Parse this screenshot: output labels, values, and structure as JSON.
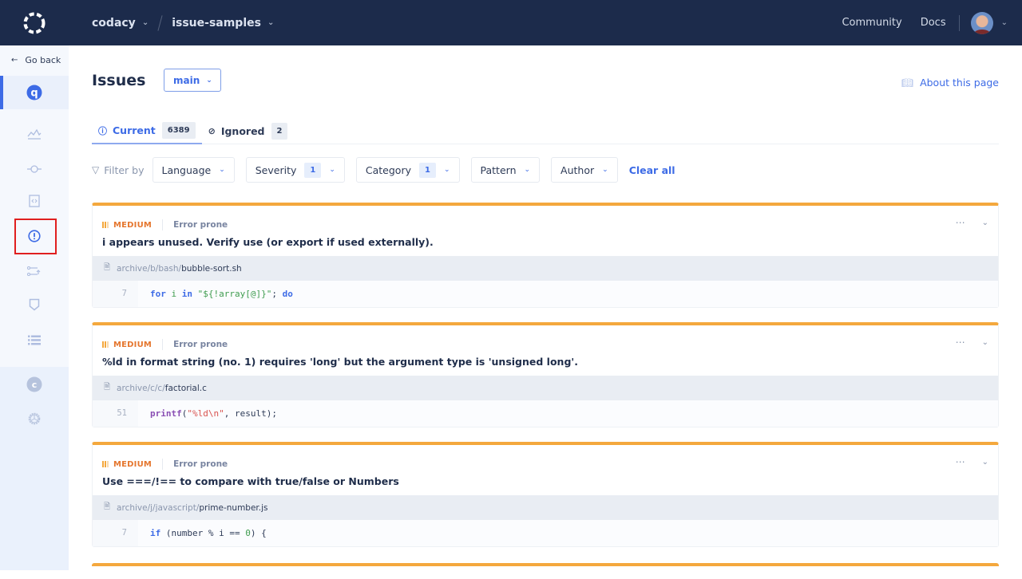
{
  "topbar": {
    "org": "codacy",
    "repo": "issue-samples",
    "links": [
      "Community",
      "Docs"
    ]
  },
  "sidebar": {
    "go_back": "Go back",
    "repo_initial": "q",
    "org_initial": "c",
    "items": [
      "dashboard",
      "commits",
      "files",
      "issues",
      "pull-requests",
      "security",
      "logs"
    ],
    "active": "issues"
  },
  "page": {
    "title": "Issues",
    "branch": "main",
    "about": "About this page"
  },
  "tabs": [
    {
      "label": "Current",
      "count": "6389",
      "active": true
    },
    {
      "label": "Ignored",
      "count": "2",
      "active": false
    }
  ],
  "filters": {
    "label": "Filter by",
    "items": [
      {
        "label": "Language",
        "count": null
      },
      {
        "label": "Severity",
        "count": "1"
      },
      {
        "label": "Category",
        "count": "1"
      },
      {
        "label": "Pattern",
        "count": null
      },
      {
        "label": "Author",
        "count": null
      }
    ],
    "clear_all": "Clear all"
  },
  "issues": [
    {
      "severity": "MEDIUM",
      "category": "Error prone",
      "title": "i appears unused. Verify use (or export if used externally).",
      "path_prefix": "archive/b/bash/",
      "file": "bubble-sort.sh",
      "line": "7",
      "code": "for i in \"${!array[@]}\"; do"
    },
    {
      "severity": "MEDIUM",
      "category": "Error prone",
      "title": "%ld in format string (no. 1) requires 'long' but the argument type is 'unsigned long'.",
      "path_prefix": "archive/c/c/",
      "file": "factorial.c",
      "line": "51",
      "code": "printf(\"%ld\\n\", result);"
    },
    {
      "severity": "MEDIUM",
      "category": "Error prone",
      "title": "Use ===/!== to compare with true/false or Numbers",
      "path_prefix": "archive/j/javascript/",
      "file": "prime-number.js",
      "line": "7",
      "code": "if (number % i == 0) {"
    }
  ],
  "colors": {
    "topbar": "#1c2b4b",
    "accent": "#3d6be6",
    "severity_medium": "#f4a83d"
  }
}
